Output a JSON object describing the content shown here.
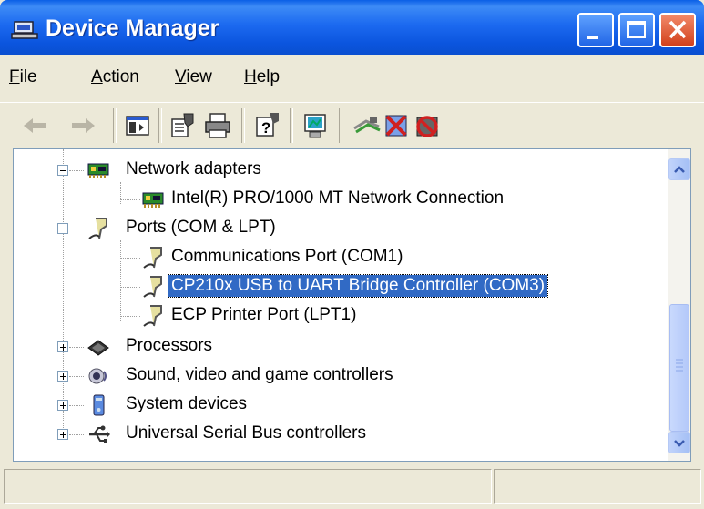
{
  "window": {
    "title": "Device Manager"
  },
  "menu": [
    {
      "key": "F",
      "rest": "ile"
    },
    {
      "key": "A",
      "rest": "ction"
    },
    {
      "key": "V",
      "rest": "iew"
    },
    {
      "key": "H",
      "rest": "elp"
    }
  ],
  "toolbar": {
    "icons": [
      "back-arrow-icon",
      "forward-arrow-icon",
      "show-hide-console-tree-icon",
      "properties-icon",
      "print-icon",
      "help-icon",
      "scan-hardware-icon",
      "update-driver-icon",
      "uninstall-icon",
      "disable-device-icon"
    ]
  },
  "tree": {
    "items": [
      {
        "label": "Network adapters",
        "level": 0,
        "expanded": true,
        "icon": "network-adapter-icon"
      },
      {
        "label": "Intel(R) PRO/1000 MT Network Connection",
        "level": 1,
        "icon": "network-adapter-icon"
      },
      {
        "label": "Ports (COM & LPT)",
        "level": 0,
        "expanded": true,
        "icon": "port-icon"
      },
      {
        "label": "Communications Port (COM1)",
        "level": 1,
        "icon": "port-icon"
      },
      {
        "label": "CP210x USB to UART Bridge Controller (COM3)",
        "level": 1,
        "icon": "port-icon",
        "selected": true
      },
      {
        "label": "ECP Printer Port (LPT1)",
        "level": 1,
        "icon": "port-icon"
      },
      {
        "label": "Processors",
        "level": 0,
        "expanded": false,
        "icon": "processor-icon"
      },
      {
        "label": "Sound, video and game controllers",
        "level": 0,
        "expanded": false,
        "icon": "sound-icon"
      },
      {
        "label": "System devices",
        "level": 0,
        "expanded": false,
        "icon": "system-device-icon"
      },
      {
        "label": "Universal Serial Bus controllers",
        "level": 0,
        "expanded": false,
        "icon": "usb-icon"
      }
    ]
  },
  "colors": {
    "titlebar": "#0a5fe6",
    "selection": "#316ac5",
    "face": "#ece9d8"
  }
}
